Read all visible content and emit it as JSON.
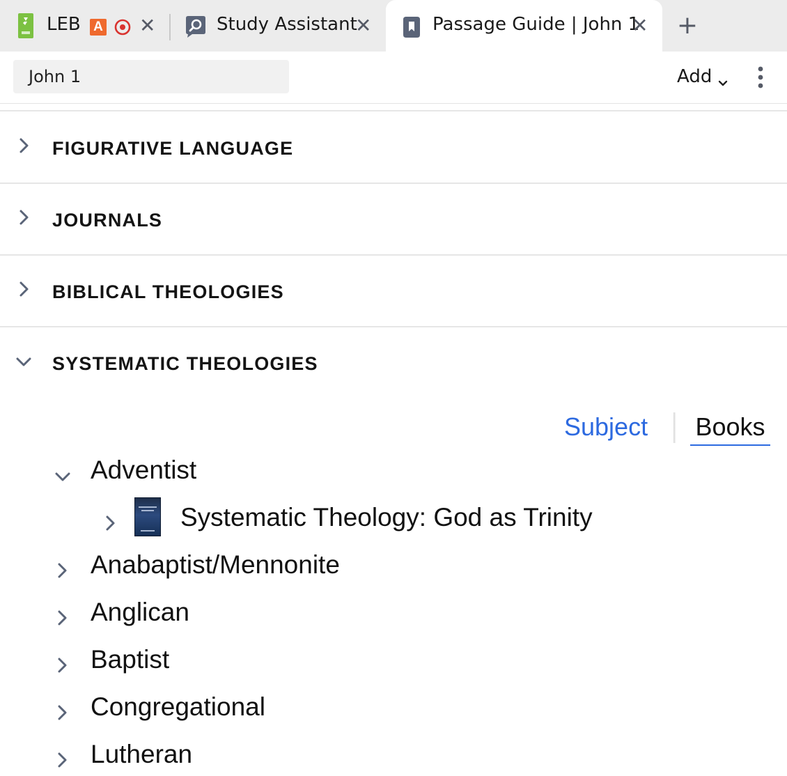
{
  "tabs": [
    {
      "label": "LEB",
      "icon": "bible-book-icon",
      "badges": [
        "A"
      ],
      "active": false
    },
    {
      "label": "Study Assistant",
      "icon": "study-assistant-icon",
      "active": false
    },
    {
      "label": "Passage Guide | John 1",
      "icon": "passage-guide-icon",
      "active": true
    }
  ],
  "toolbar": {
    "reference": "John 1",
    "add_label": "Add"
  },
  "sections": [
    {
      "title": "FIGURATIVE LANGUAGE",
      "expanded": false
    },
    {
      "title": "JOURNALS",
      "expanded": false
    },
    {
      "title": "BIBLICAL THEOLOGIES",
      "expanded": false
    },
    {
      "title": "SYSTEMATIC THEOLOGIES",
      "expanded": true
    }
  ],
  "view_toggle": {
    "options": [
      "Subject",
      "Books"
    ],
    "selected": "Books"
  },
  "tree": [
    {
      "label": "Adventist",
      "expanded": true,
      "children": [
        {
          "label": "Systematic Theology: God as Trinity",
          "has_cover": true
        }
      ]
    },
    {
      "label": "Anabaptist/Mennonite",
      "expanded": false
    },
    {
      "label": "Anglican",
      "expanded": false
    },
    {
      "label": "Baptist",
      "expanded": false
    },
    {
      "label": "Congregational",
      "expanded": false
    },
    {
      "label": "Lutheran",
      "expanded": false
    }
  ],
  "colors": {
    "accent": "#2d6ae0",
    "leb_green": "#7cc142",
    "badge_orange": "#ef6a2e",
    "target_red": "#d9332f",
    "icon_slate": "#5a6478"
  }
}
